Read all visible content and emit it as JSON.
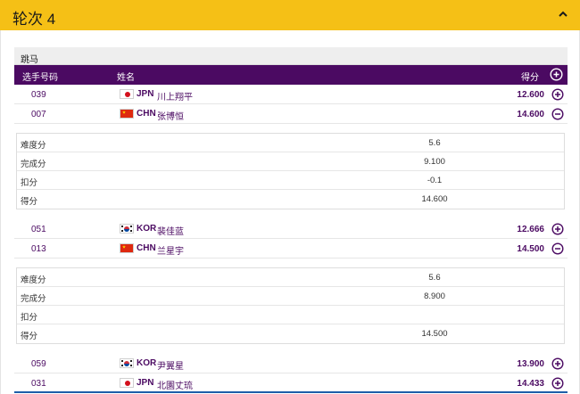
{
  "header": {
    "title": "轮次 4"
  },
  "filter": {
    "label": "跳马"
  },
  "table_header": {
    "bib": "选手号码",
    "name": "姓名",
    "score": "得分"
  },
  "rows": [
    {
      "bib": "039",
      "country": "JPN",
      "athlete": "川上翔平",
      "score": "12.600",
      "flag": "jpn",
      "expanded": false
    },
    {
      "bib": "007",
      "country": "CHN",
      "athlete": "张博恒",
      "score": "14.600",
      "flag": "chn",
      "expanded": true
    },
    {
      "bib": "051",
      "country": "KOR",
      "athlete": "裴佳蓝",
      "score": "12.666",
      "flag": "kor",
      "expanded": false
    },
    {
      "bib": "013",
      "country": "CHN",
      "athlete": "兰星宇",
      "score": "14.500",
      "flag": "chn",
      "expanded": true
    },
    {
      "bib": "059",
      "country": "KOR",
      "athlete": "尹翼星",
      "score": "13.900",
      "flag": "kor",
      "expanded": false
    },
    {
      "bib": "031",
      "country": "JPN",
      "athlete": "北園丈琉",
      "score": "14.433",
      "flag": "jpn",
      "expanded": false
    }
  ],
  "details": [
    {
      "items": [
        {
          "label": "难度分",
          "value": "5.6"
        },
        {
          "label": "完成分",
          "value": "9.100"
        },
        {
          "label": "扣分",
          "value": "-0.1"
        },
        {
          "label": "得分",
          "value": "14.600"
        }
      ]
    },
    {
      "items": [
        {
          "label": "难度分",
          "value": "5.6"
        },
        {
          "label": "完成分",
          "value": "8.900"
        },
        {
          "label": "扣分",
          "value": ""
        },
        {
          "label": "得分",
          "value": "14.500"
        }
      ]
    }
  ],
  "colors": {
    "header_bg": "#f5c016",
    "table_header_bg": "#4b0a62",
    "accent": "#4b0a62"
  },
  "icons": {
    "collapse": "chevron-up-icon",
    "expand": "plus-circle-icon",
    "collapse_row": "minus-circle-icon"
  }
}
